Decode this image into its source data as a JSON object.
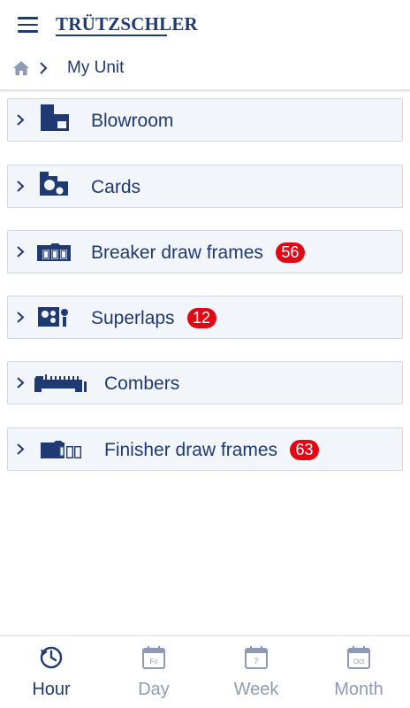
{
  "header": {
    "brand": "TRÜTZSCHLER",
    "breadcrumb": {
      "current": "My Unit"
    }
  },
  "sections": [
    {
      "label": "Blowroom",
      "badge": null,
      "icon": "blowroom-icon"
    },
    {
      "label": "Cards",
      "badge": null,
      "icon": "cards-icon"
    },
    {
      "label": "Breaker draw frames",
      "badge": "56",
      "icon": "breaker-draw-frame-icon"
    },
    {
      "label": "Superlaps",
      "badge": "12",
      "icon": "superlap-icon"
    },
    {
      "label": "Combers",
      "badge": null,
      "icon": "comber-icon"
    },
    {
      "label": "Finisher draw frames",
      "badge": "63",
      "icon": "finisher-draw-frame-icon"
    }
  ],
  "tabs": [
    {
      "label": "Hour",
      "active": true,
      "icon": "clock-icon",
      "icon_text": ""
    },
    {
      "label": "Day",
      "active": false,
      "icon": "calendar-day-icon",
      "icon_text": "Fri"
    },
    {
      "label": "Week",
      "active": false,
      "icon": "calendar-week-icon",
      "icon_text": "7"
    },
    {
      "label": "Month",
      "active": false,
      "icon": "calendar-month-icon",
      "icon_text": "Oct"
    }
  ],
  "colors": {
    "primary": "#1f3a73",
    "section_bg": "#f2f5fa",
    "badge": "#e30613",
    "inactive_tab": "#8e9ab5"
  }
}
